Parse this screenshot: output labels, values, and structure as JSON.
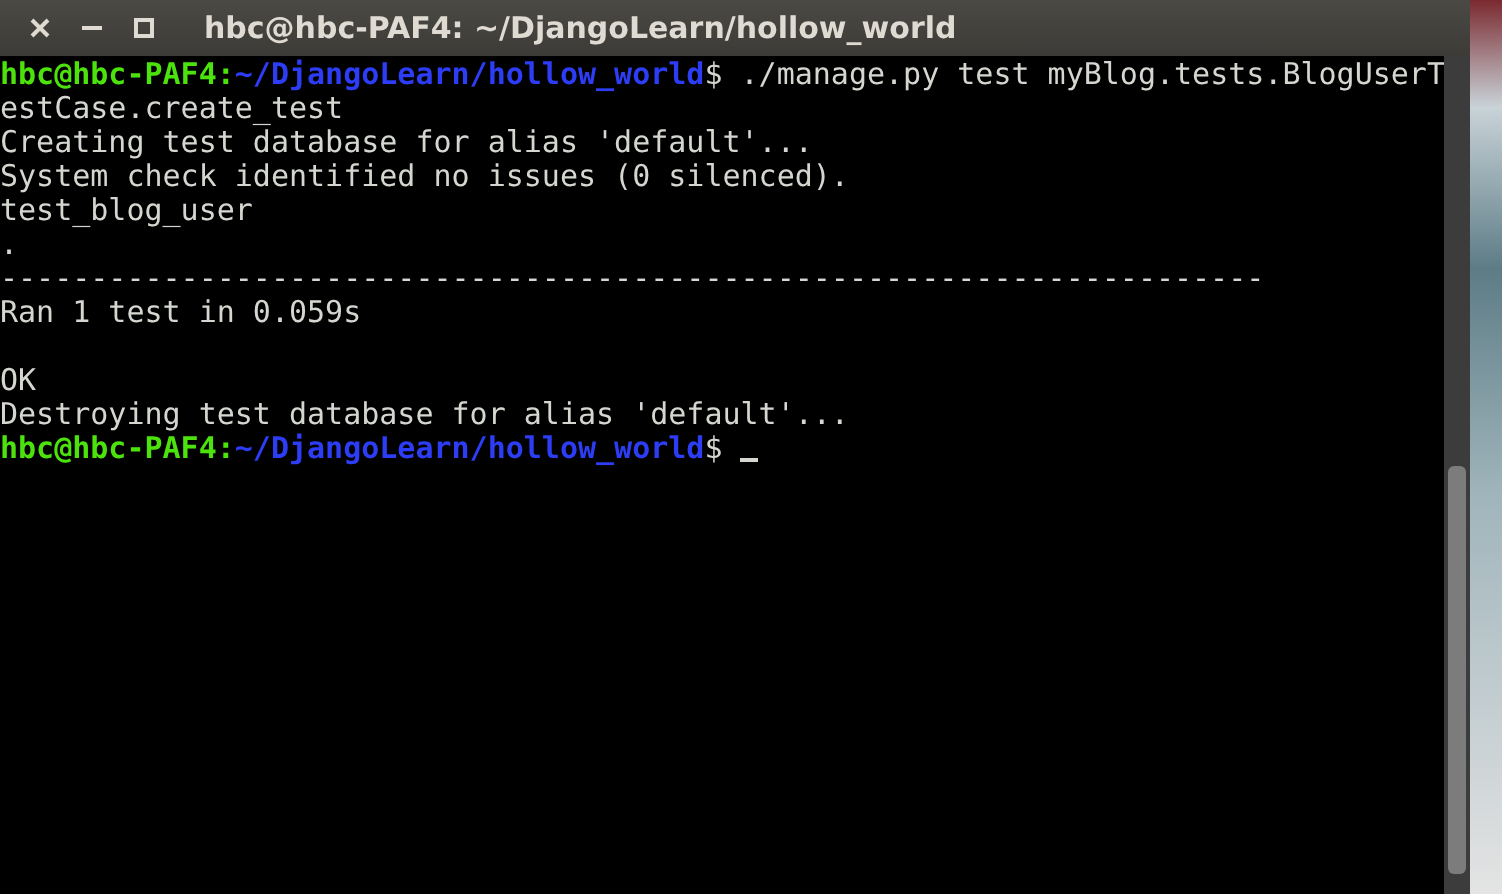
{
  "window": {
    "title": "hbc@hbc-PAF4: ~/DjangoLearn/hollow_world"
  },
  "terminal": {
    "lines": [
      {
        "kind": "prompt",
        "user": "hbc@hbc-PAF4:",
        "path": "~/DjangoLearn/hollow_world",
        "symbol": "$",
        "command": "./manage.py test myBlog.tests.BlogUserT"
      },
      {
        "kind": "output",
        "text": "estCase.create_test"
      },
      {
        "kind": "output",
        "text": "Creating test database for alias 'default'..."
      },
      {
        "kind": "output",
        "text": "System check identified no issues (0 silenced)."
      },
      {
        "kind": "output",
        "text": "test_blog_user"
      },
      {
        "kind": "output",
        "text": "."
      },
      {
        "kind": "output",
        "text": "----------------------------------------------------------------------"
      },
      {
        "kind": "output",
        "text": "Ran 1 test in 0.059s"
      },
      {
        "kind": "blank"
      },
      {
        "kind": "output",
        "text": "OK"
      },
      {
        "kind": "output",
        "text": "Destroying test database for alias 'default'..."
      },
      {
        "kind": "prompt",
        "user": "hbc@hbc-PAF4:",
        "path": "~/DjangoLearn/hollow_world",
        "symbol": "$",
        "cursor": true
      }
    ]
  }
}
